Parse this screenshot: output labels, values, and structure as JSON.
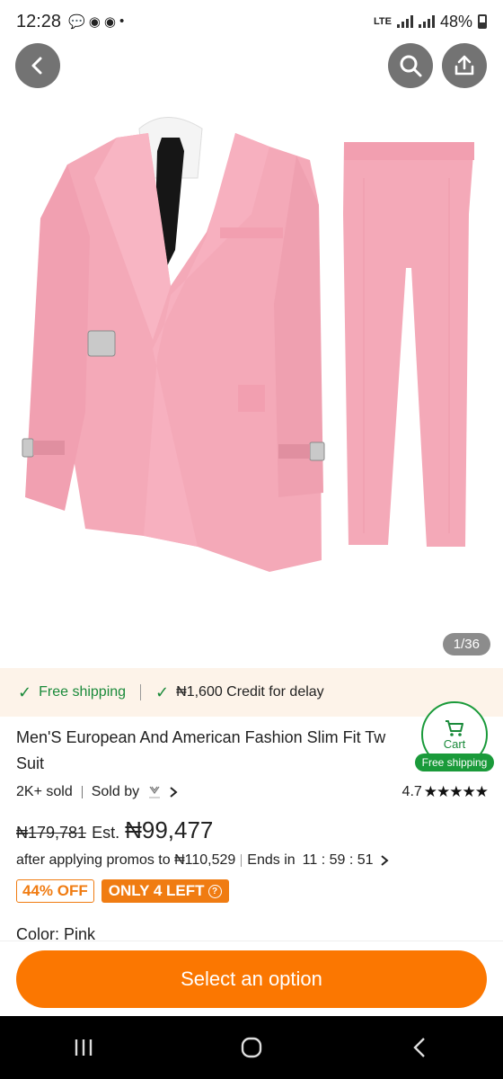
{
  "status": {
    "time": "12:28",
    "notif_icons": [
      "chat-bubble-icon",
      "basketball-icon",
      "basketball-icon",
      "dot-icon"
    ],
    "network": "LTE",
    "battery": "48%"
  },
  "hero": {
    "image_counter": "1/36"
  },
  "shipping": {
    "free": "Free shipping",
    "credit": "₦1,600 Credit for delay"
  },
  "cart": {
    "label": "Cart",
    "pill": "Free shipping"
  },
  "product": {
    "title": "Men'S European And American Fashion Slim Fit Tw... Suit",
    "title_line1": "Men'S European And American Fashion Slim Fit Tw",
    "title_line2": "Suit",
    "sold": "2K+ sold",
    "sold_by": "Sold by",
    "rating": "4.7",
    "stars": "★★★★★",
    "old_price": "₦179,781",
    "est_label": "Est.",
    "price": "₦99,477",
    "promo_text": "after applying promos to ₦110,529",
    "ends_label": "Ends in",
    "countdown": "11 : 59 : 51",
    "discount_badge": "44% OFF",
    "stock_badge": "ONLY 4 LEFT",
    "color_label": "Color: Pink"
  },
  "footer": {
    "select_button": "Select an option"
  },
  "colors": {
    "accent_orange": "#fb7701",
    "green": "#1a8a3a",
    "suit_pink": "#f4a9b8"
  }
}
